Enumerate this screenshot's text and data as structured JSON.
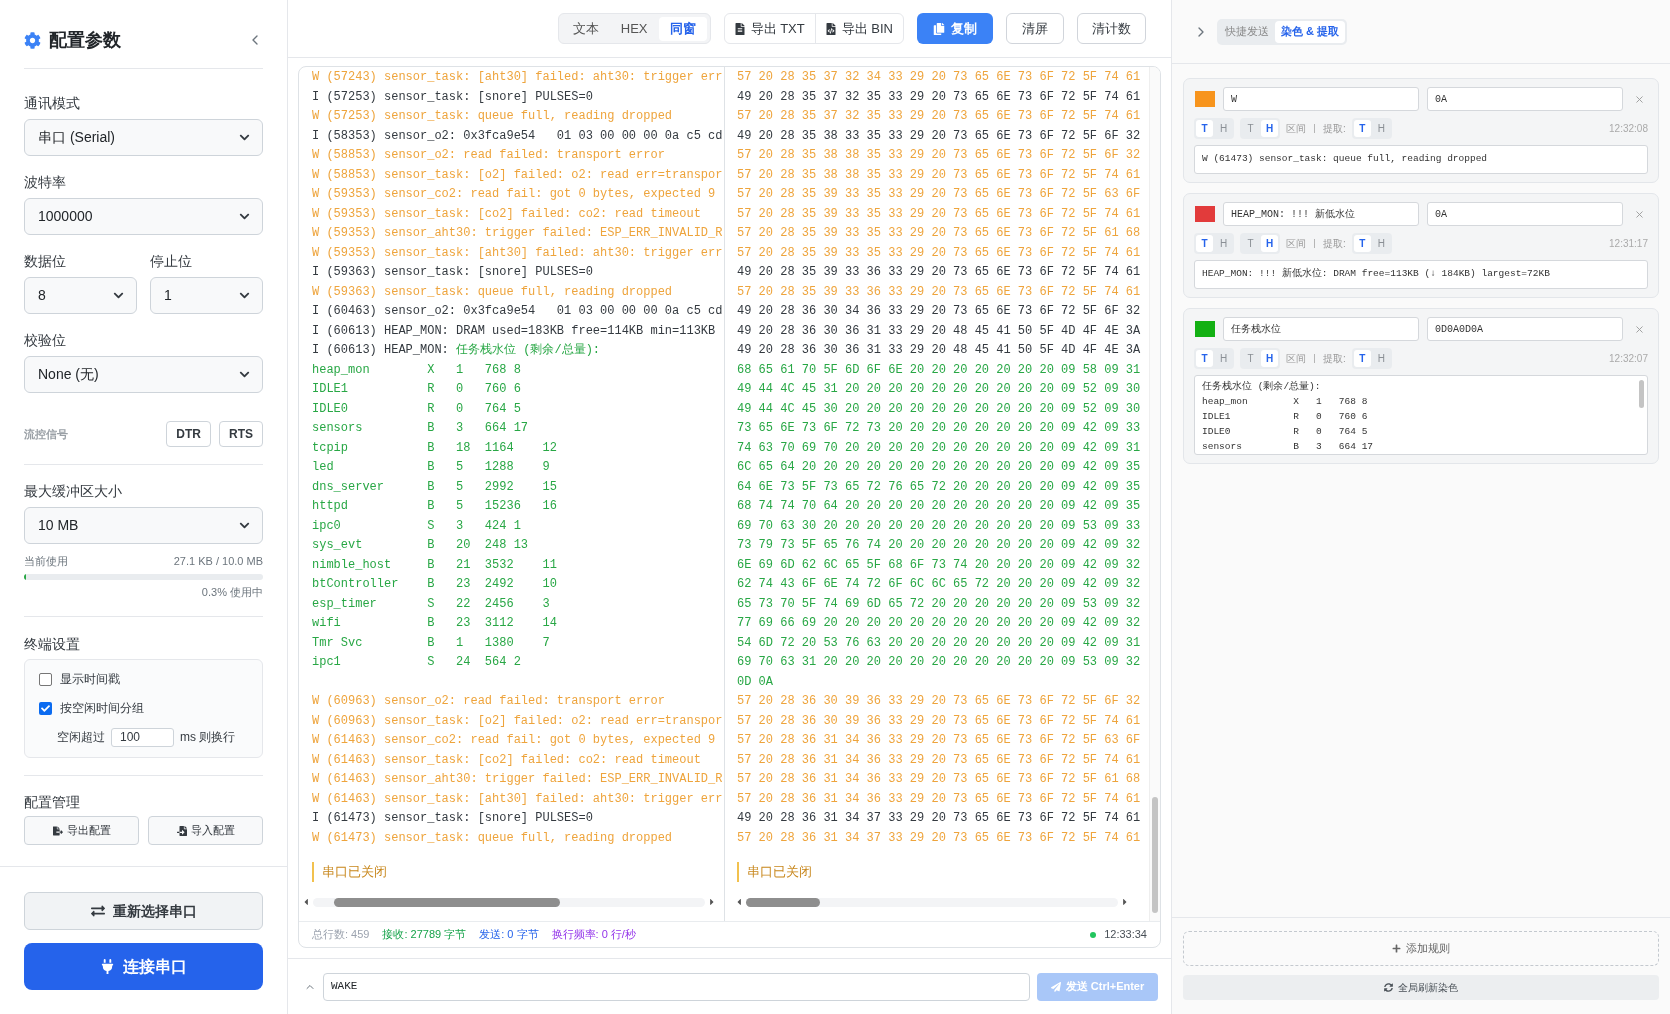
{
  "sidebar": {
    "title": "配置参数",
    "mode": {
      "label": "通讯模式",
      "value": "串口 (Serial)"
    },
    "baud": {
      "label": "波特率",
      "value": "1000000"
    },
    "data_bits": {
      "label": "数据位",
      "value": "8"
    },
    "stop_bits": {
      "label": "停止位",
      "value": "1"
    },
    "parity": {
      "label": "校验位",
      "value": "None (无)"
    },
    "flow_control": {
      "label": "流控信号",
      "buttons": [
        "DTR",
        "RTS"
      ]
    },
    "buffer": {
      "label": "最大缓冲区大小",
      "value": "10 MB",
      "usage_label": "当前使用",
      "usage": "27.1 KB / 10.0 MB",
      "level": 0.003,
      "percent": "0.3% 使用中"
    },
    "terminal": {
      "title": "终端设置",
      "options": [
        {
          "label": "显示时间戳",
          "checked": false
        },
        {
          "label": "按空闲时间分组",
          "checked": true
        }
      ],
      "idle": {
        "prefix": "空闲超过",
        "value": "100",
        "suffix": "ms 则换行"
      }
    },
    "config": {
      "title": "配置管理",
      "buttons": [
        {
          "kind": "export",
          "label": "导出配置"
        },
        {
          "kind": "import",
          "label": "导入配置"
        }
      ]
    },
    "reselect_button": "重新选择串口",
    "connect_button": "连接串口"
  },
  "toolbar": {
    "view_modes": [
      {
        "label": "文本",
        "selected": false
      },
      {
        "label": "HEX",
        "selected": false
      },
      {
        "label": "同窗",
        "selected": true
      }
    ],
    "export_buttons": [
      {
        "kind": "txt",
        "label": "导出 TXT"
      },
      {
        "kind": "bin",
        "label": "导出 BIN"
      }
    ],
    "copy_button": "复制",
    "clear_button": "清屏",
    "reset_button": "清计数"
  },
  "log": {
    "text_lines": [
      {
        "kind": "warn",
        "text": "W (57243) sensor_task: [aht30] failed: aht30: trigger err"
      },
      {
        "kind": "info",
        "text": "I (57253) sensor_task: [snore] PULSES=0"
      },
      {
        "kind": "warn",
        "text": "W (57253) sensor_task: queue full, reading dropped"
      },
      {
        "kind": "info",
        "text": "I (58353) sensor_o2: 0x3fca9e54   01 03 00 00 00 0a c5 cd"
      },
      {
        "kind": "warn",
        "text": "W (58853) sensor_o2: read failed: transport error"
      },
      {
        "kind": "warn",
        "text": "W (58853) sensor_task: [o2] failed: o2: read err=transpor"
      },
      {
        "kind": "warn",
        "text": "W (59353) sensor_co2: read fail: got 0 bytes, expected 9"
      },
      {
        "kind": "warn",
        "text": "W (59353) sensor_task: [co2] failed: co2: read timeout"
      },
      {
        "kind": "warn",
        "text": "W (59353) sensor_aht30: trigger failed: ESP_ERR_INVALID_R"
      },
      {
        "kind": "warn",
        "text": "W (59353) sensor_task: [aht30] failed: aht30: trigger err"
      },
      {
        "kind": "info",
        "text": "I (59363) sensor_task: [snore] PULSES=0"
      },
      {
        "kind": "warn",
        "text": "W (59363) sensor_task: queue full, reading dropped"
      },
      {
        "kind": "info",
        "text": "I (60463) sensor_o2: 0x3fca9e54   01 03 00 00 00 0a c5 cd"
      },
      {
        "kind": "info",
        "text": "I (60613) HEAP_MON: DRAM used=183KB free=114KB min=113KB"
      },
      {
        "kind": "info",
        "text": "I (60613) HEAP_MON: ",
        "match": "任务栈水位 (剩余/总量):"
      },
      {
        "kind": "match",
        "text": "heap_mon       \tX\t1\t768\t8"
      },
      {
        "kind": "match",
        "text": "IDLE1          \tR\t0\t760\t6"
      },
      {
        "kind": "match",
        "text": "IDLE0          \tR\t0\t764\t5"
      },
      {
        "kind": "match",
        "text": "sensors        \tB\t3\t664\t17"
      },
      {
        "kind": "match",
        "text": "tcpip          \tB\t18\t1164\t12"
      },
      {
        "kind": "match",
        "text": "led            \tB\t5\t1288\t9"
      },
      {
        "kind": "match",
        "text": "dns_server     \tB\t5\t2992\t15"
      },
      {
        "kind": "match",
        "text": "httpd          \tB\t5\t15236\t16"
      },
      {
        "kind": "match",
        "text": "ipc0           \tS\t3\t424\t1"
      },
      {
        "kind": "match",
        "text": "sys_evt        \tB\t20\t248\t13"
      },
      {
        "kind": "match",
        "text": "nimble_host    \tB\t21\t3532\t11"
      },
      {
        "kind": "match",
        "text": "btController   \tB\t23\t2492\t10"
      },
      {
        "kind": "match",
        "text": "esp_timer      \tS\t22\t2456\t3"
      },
      {
        "kind": "match",
        "text": "wifi           \tB\t23\t3112\t14"
      },
      {
        "kind": "match",
        "text": "Tmr Svc        \tB\t1\t1380\t7"
      },
      {
        "kind": "match",
        "text": "ipc1           \tS\t24\t564\t2"
      },
      {
        "kind": "blank"
      },
      {
        "kind": "warn",
        "text": "W (60963) sensor_o2: read failed: transport error"
      },
      {
        "kind": "warn",
        "text": "W (60963) sensor_task: [o2] failed: o2: read err=transpor"
      },
      {
        "kind": "warn",
        "text": "W (61463) sensor_co2: read fail: got 0 bytes, expected 9"
      },
      {
        "kind": "warn",
        "text": "W (61463) sensor_task: [co2] failed: co2: read timeout"
      },
      {
        "kind": "warn",
        "text": "W (61463) sensor_aht30: trigger failed: ESP_ERR_INVALID_R"
      },
      {
        "kind": "warn",
        "text": "W (61463) sensor_task: [aht30] failed: aht30: trigger err"
      },
      {
        "kind": "info",
        "text": "I (61473) sensor_task: [snore] PULSES=0"
      },
      {
        "kind": "warn",
        "text": "W (61473) sensor_task: queue full, reading dropped"
      }
    ],
    "text_notice": "串口已关闭",
    "hex_lines": [
      {
        "kind": "warn",
        "text": "57 20 28 35 37 32 34 33 29 20 73 65 6E 73 6F 72 5F 74 61"
      },
      {
        "kind": "info",
        "text": "49 20 28 35 37 32 35 33 29 20 73 65 6E 73 6F 72 5F 74 61"
      },
      {
        "kind": "warn",
        "text": "57 20 28 35 37 32 35 33 29 20 73 65 6E 73 6F 72 5F 74 61"
      },
      {
        "kind": "info",
        "text": "49 20 28 35 38 33 35 33 29 20 73 65 6E 73 6F 72 5F 6F 32"
      },
      {
        "kind": "warn",
        "text": "57 20 28 35 38 38 35 33 29 20 73 65 6E 73 6F 72 5F 6F 32"
      },
      {
        "kind": "warn",
        "text": "57 20 28 35 38 38 35 33 29 20 73 65 6E 73 6F 72 5F 74 61"
      },
      {
        "kind": "warn",
        "text": "57 20 28 35 39 33 35 33 29 20 73 65 6E 73 6F 72 5F 63 6F"
      },
      {
        "kind": "warn",
        "text": "57 20 28 35 39 33 35 33 29 20 73 65 6E 73 6F 72 5F 74 61"
      },
      {
        "kind": "warn",
        "text": "57 20 28 35 39 33 35 33 29 20 73 65 6E 73 6F 72 5F 61 68"
      },
      {
        "kind": "warn",
        "text": "57 20 28 35 39 33 35 33 29 20 73 65 6E 73 6F 72 5F 74 61"
      },
      {
        "kind": "info",
        "text": "49 20 28 35 39 33 36 33 29 20 73 65 6E 73 6F 72 5F 74 61"
      },
      {
        "kind": "warn",
        "text": "57 20 28 35 39 33 36 33 29 20 73 65 6E 73 6F 72 5F 74 61"
      },
      {
        "kind": "info",
        "text": "49 20 28 36 30 34 36 33 29 20 73 65 6E 73 6F 72 5F 6F 32"
      },
      {
        "kind": "info",
        "text": "49 20 28 36 30 36 31 33 29 20 48 45 41 50 5F 4D 4F 4E 3A"
      },
      {
        "kind": "info",
        "text": "49 20 28 36 30 36 31 33 29 20 48 45 41 50 5F 4D 4F 4E 3A"
      },
      {
        "kind": "match",
        "text": "68 65 61 70 5F 6D 6F 6E 20 20 20 20 20 20 20 09 58 09 31"
      },
      {
        "kind": "match",
        "text": "49 44 4C 45 31 20 20 20 20 20 20 20 20 20 20 09 52 09 30"
      },
      {
        "kind": "match",
        "text": "49 44 4C 45 30 20 20 20 20 20 20 20 20 20 20 09 52 09 30"
      },
      {
        "kind": "match",
        "text": "73 65 6E 73 6F 72 73 20 20 20 20 20 20 20 20 09 42 09 33"
      },
      {
        "kind": "match",
        "text": "74 63 70 69 70 20 20 20 20 20 20 20 20 20 20 09 42 09 31"
      },
      {
        "kind": "match",
        "text": "6C 65 64 20 20 20 20 20 20 20 20 20 20 20 20 09 42 09 35"
      },
      {
        "kind": "match",
        "text": "64 6E 73 5F 73 65 72 76 65 72 20 20 20 20 20 09 42 09 35"
      },
      {
        "kind": "match",
        "text": "68 74 74 70 64 20 20 20 20 20 20 20 20 20 20 09 42 09 35"
      },
      {
        "kind": "match",
        "text": "69 70 63 30 20 20 20 20 20 20 20 20 20 20 20 09 53 09 33"
      },
      {
        "kind": "match",
        "text": "73 79 73 5F 65 76 74 20 20 20 20 20 20 20 20 09 42 09 32"
      },
      {
        "kind": "match",
        "text": "6E 69 6D 62 6C 65 5F 68 6F 73 74 20 20 20 20 09 42 09 32"
      },
      {
        "kind": "match",
        "text": "62 74 43 6F 6E 74 72 6F 6C 6C 65 72 20 20 20 09 42 09 32"
      },
      {
        "kind": "match",
        "text": "65 73 70 5F 74 69 6D 65 72 20 20 20 20 20 20 09 53 09 32"
      },
      {
        "kind": "match",
        "text": "77 69 66 69 20 20 20 20 20 20 20 20 20 20 20 09 42 09 32"
      },
      {
        "kind": "match",
        "text": "54 6D 72 20 53 76 63 20 20 20 20 20 20 20 20 09 42 09 31"
      },
      {
        "kind": "match",
        "text": "69 70 63 31 20 20 20 20 20 20 20 20 20 20 20 09 53 09 32"
      },
      {
        "kind": "match",
        "text": "0D 0A"
      },
      {
        "kind": "warn",
        "text": "57 20 28 36 30 39 36 33 29 20 73 65 6E 73 6F 72 5F 6F 32"
      },
      {
        "kind": "warn",
        "text": "57 20 28 36 30 39 36 33 29 20 73 65 6E 73 6F 72 5F 74 61"
      },
      {
        "kind": "warn",
        "text": "57 20 28 36 31 34 36 33 29 20 73 65 6E 73 6F 72 5F 63 6F"
      },
      {
        "kind": "warn",
        "text": "57 20 28 36 31 34 36 33 29 20 73 65 6E 73 6F 72 5F 74 61"
      },
      {
        "kind": "warn",
        "text": "57 20 28 36 31 34 36 33 29 20 73 65 6E 73 6F 72 5F 61 68"
      },
      {
        "kind": "warn",
        "text": "57 20 28 36 31 34 36 33 29 20 73 65 6E 73 6F 72 5F 74 61"
      },
      {
        "kind": "info",
        "text": "49 20 28 36 31 34 37 33 29 20 73 65 6E 73 6F 72 5F 74 61"
      },
      {
        "kind": "warn",
        "text": "57 20 28 36 31 34 37 33 29 20 73 65 6E 73 6F 72 5F 74 61"
      }
    ],
    "hex_notice": "串口已关闭"
  },
  "status_bar": {
    "items": [
      {
        "kind": "total",
        "text": "总行数: 459"
      },
      {
        "kind": "rx",
        "text": "接收: 27789 字节"
      },
      {
        "kind": "tx",
        "text": "发送: 0 字节"
      },
      {
        "kind": "rate",
        "text": "换行频率: 0 行/秒"
      }
    ],
    "time": "12:33:34"
  },
  "send": {
    "value": "WAKE",
    "button": "发送 Ctrl+Enter",
    "disabled": true
  },
  "panel_tabs": [
    {
      "label": "快捷发送",
      "selected": false
    },
    {
      "label": "染色 & 提取",
      "selected": true
    }
  ],
  "rules": [
    {
      "color": "#f7941d",
      "pattern": "W",
      "end_pattern": "0A",
      "pattern_modes": [
        {
          "label": "T",
          "selected": true
        },
        {
          "label": "H",
          "selected": false
        }
      ],
      "end_modes": [
        {
          "label": "T",
          "selected": false
        },
        {
          "label": "H",
          "selected": true
        }
      ],
      "range_label": "区间",
      "extract_label": "提取:",
      "extract_modes": [
        {
          "label": "T",
          "selected": true
        },
        {
          "label": "H",
          "selected": false
        }
      ],
      "time": "12:32:08",
      "preview": [
        "W (61473) sensor_task: queue full, reading dropped"
      ]
    },
    {
      "color": "#e23b3b",
      "pattern": "HEAP_MON: !!! 新低水位",
      "end_pattern": "0A",
      "pattern_modes": [
        {
          "label": "T",
          "selected": true
        },
        {
          "label": "H",
          "selected": false
        }
      ],
      "end_modes": [
        {
          "label": "T",
          "selected": false
        },
        {
          "label": "H",
          "selected": true
        }
      ],
      "range_label": "区间",
      "extract_label": "提取:",
      "extract_modes": [
        {
          "label": "T",
          "selected": true
        },
        {
          "label": "H",
          "selected": false
        }
      ],
      "time": "12:31:17",
      "preview": [
        "HEAP_MON: !!! 新低水位: DRAM free=113KB (↓ 184KB) largest=72KB"
      ]
    },
    {
      "color": "#13b013",
      "pattern": "任务栈水位",
      "end_pattern": "0D0A0D0A",
      "pattern_modes": [
        {
          "label": "T",
          "selected": true
        },
        {
          "label": "H",
          "selected": false
        }
      ],
      "end_modes": [
        {
          "label": "T",
          "selected": false
        },
        {
          "label": "H",
          "selected": true
        }
      ],
      "range_label": "区间",
      "extract_label": "提取:",
      "extract_modes": [
        {
          "label": "T",
          "selected": true
        },
        {
          "label": "H",
          "selected": false
        }
      ],
      "time": "12:32:07",
      "preview": [
        "任务栈水位 (剩余/总量):",
        "heap_mon       \tX\t1\t768\t8",
        "IDLE1          \tR\t0\t760\t6",
        "IDLE0          \tR\t0\t764\t5",
        "sensors        \tB\t3\t664\t17"
      ]
    }
  ],
  "add_rule_button": "添加规则",
  "refresh_button": "全局刷新染色"
}
